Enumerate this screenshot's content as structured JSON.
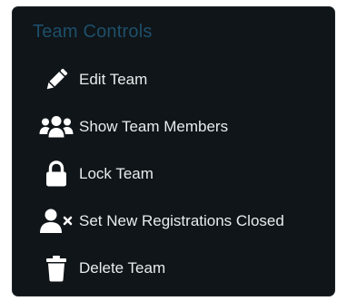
{
  "panel": {
    "title": "Team Controls"
  },
  "menu": {
    "items": [
      {
        "label": "Edit Team",
        "icon": "pencil-icon"
      },
      {
        "label": "Show Team Members",
        "icon": "users-icon"
      },
      {
        "label": "Lock Team",
        "icon": "lock-icon"
      },
      {
        "label": "Set New Registrations Closed",
        "icon": "user-times-icon"
      },
      {
        "label": "Delete Team",
        "icon": "trash-icon"
      }
    ]
  },
  "colors": {
    "panel_background": "#0f1518",
    "title_color": "#1e4f6b",
    "text_color": "#e8ecee",
    "icon_color": "#ffffff"
  }
}
